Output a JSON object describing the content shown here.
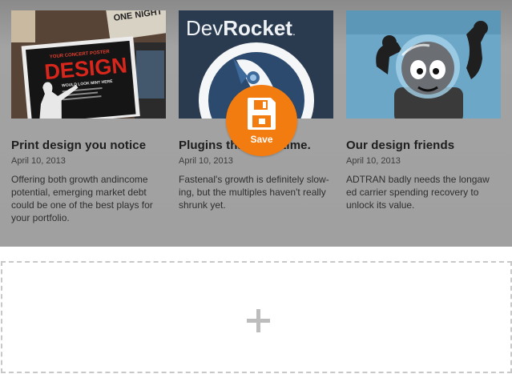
{
  "cards": [
    {
      "title": "Print design you notice",
      "date": "April 10, 2013",
      "excerpt": "Offering both growth andincome potential, emerging market debt could be one of the best plays for your portfolio.",
      "thumb": {
        "icon": "design-poster-image",
        "poster_headline": "DESIGN",
        "poster_top": "YOUR CONCERT POSTER",
        "poster_bottom": "WOULD LOOK MINT HERE",
        "corner_text": "ONE NIGHT"
      }
    },
    {
      "title": "Plugins that save time.",
      "date": "April 10, 2013",
      "excerpt": "Fastenal's growth is definitely slow-ing, but the multiples haven't really shrunk yet.",
      "thumb": {
        "icon": "devrocket-rocket-image",
        "brand_part1": "Dev",
        "brand_part2": "Rocket",
        "brand_suffix": "."
      }
    },
    {
      "title": "Our design friends",
      "date": "April 10, 2013",
      "excerpt": "ADTRAN badly needs the longaw ed carrier spending recovery to unlock its value.",
      "thumb": {
        "icon": "astronaut-robot-image"
      }
    }
  ],
  "save": {
    "label": "Save",
    "icon": "floppy-disk-icon",
    "color": "#f37c11"
  },
  "add_block": {
    "icon": "plus-icon"
  },
  "colors": {
    "overlay": "#a3a3a3",
    "toolbar": "#4d4d4d"
  }
}
